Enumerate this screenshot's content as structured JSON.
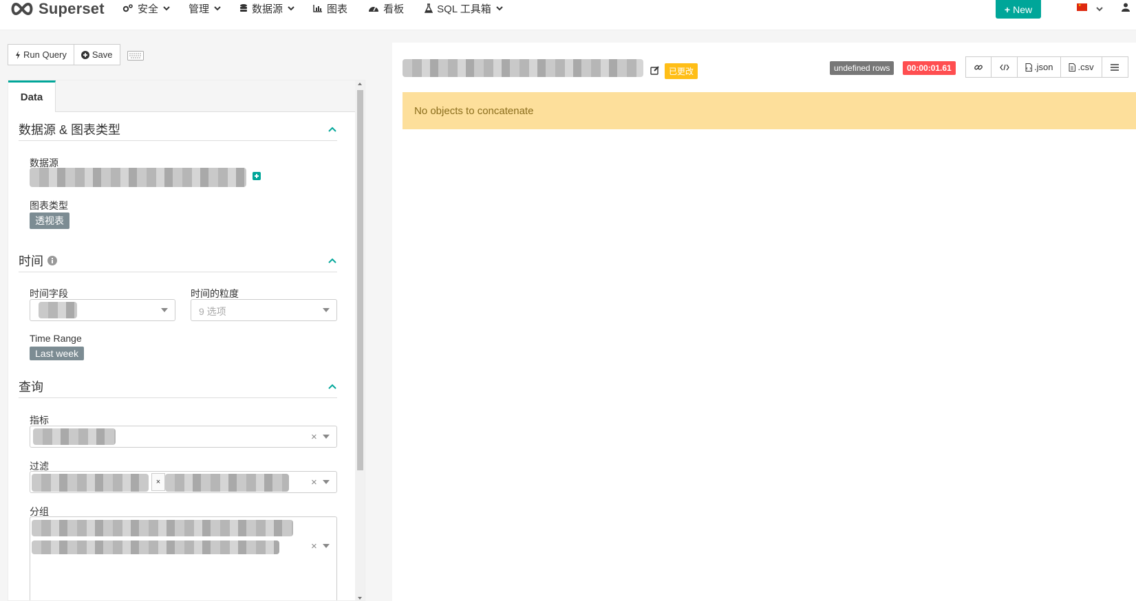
{
  "navbar": {
    "brand": "Superset",
    "menu": [
      {
        "label": "安全",
        "icon": "cogs-icon",
        "dropdown": true
      },
      {
        "label": "管理",
        "icon": "",
        "dropdown": true
      },
      {
        "label": "数据源",
        "icon": "database-icon",
        "dropdown": true
      },
      {
        "label": "图表",
        "icon": "bar-chart-icon",
        "dropdown": false
      },
      {
        "label": "看板",
        "icon": "dashboard-icon",
        "dropdown": false
      },
      {
        "label": "SQL 工具箱",
        "icon": "flask-icon",
        "dropdown": true
      }
    ],
    "new_label": "New",
    "accent": "#00a699"
  },
  "toolbar": {
    "run_query_label": "Run Query",
    "save_label": "Save"
  },
  "tabs": {
    "data_label": "Data"
  },
  "sections": {
    "datasource": {
      "title": "数据源 & 图表类型",
      "datasource_label": "数据源",
      "viz_type_label": "图表类型",
      "viz_type_value": "透视表"
    },
    "time": {
      "title": "时间",
      "time_column_label": "时间字段",
      "time_grain_label": "时间的粒度",
      "time_grain_placeholder": "9 选项",
      "time_range_label": "Time Range",
      "time_range_value": "Last week"
    },
    "query": {
      "title": "查询",
      "metrics_label": "指标",
      "filters_label": "过滤",
      "groupby_label": "分组"
    }
  },
  "result": {
    "changed_badge": "已更改",
    "rows_badge": "undefined rows",
    "time_badge": "00:00:01.61",
    "json_label": ".json",
    "csv_label": ".csv",
    "alert_message": "No objects to concatenate"
  }
}
